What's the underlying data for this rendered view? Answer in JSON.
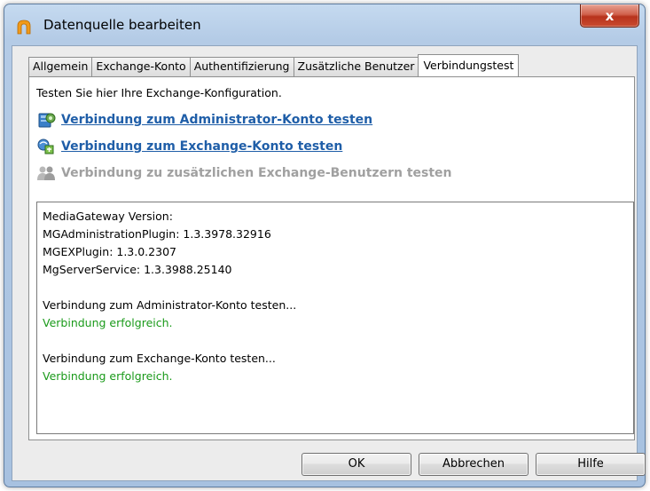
{
  "window": {
    "title": "Datenquelle bearbeiten",
    "close_label": "x"
  },
  "tabs": [
    {
      "label": "Allgemein"
    },
    {
      "label": "Exchange-Konto"
    },
    {
      "label": "Authentifizierung"
    },
    {
      "label": "Zusätzliche Benutzer"
    },
    {
      "label": "Verbindungstest",
      "active": true
    }
  ],
  "panel": {
    "intro": "Testen Sie hier Ihre Exchange-Konfiguration.",
    "actions": [
      {
        "label": "Verbindung zum Administrator-Konto testen",
        "enabled": true,
        "icon": "admin-account-icon"
      },
      {
        "label": "Verbindung zum Exchange-Konto testen",
        "enabled": true,
        "icon": "exchange-account-icon"
      },
      {
        "label": "Verbindung zu zusätzlichen Exchange-Benutzern testen",
        "enabled": false,
        "icon": "users-icon"
      }
    ],
    "log": [
      "MediaGateway Version:",
      "MGAdministrationPlugin: 1.3.3978.32916",
      "MGEXPlugin: 1.3.0.2307",
      "MgServerService: 1.3.3988.25140",
      "",
      "Verbindung zum Administrator-Konto testen...",
      "Verbindung erfolgreich.",
      "",
      "Verbindung zum Exchange-Konto testen...",
      "Verbindung erfolgreich."
    ],
    "success_color": "#1a9a1a",
    "link_color": "#1f5ea8"
  },
  "buttons": {
    "ok": "OK",
    "cancel": "Abbrechen",
    "help": "Hilfe"
  }
}
